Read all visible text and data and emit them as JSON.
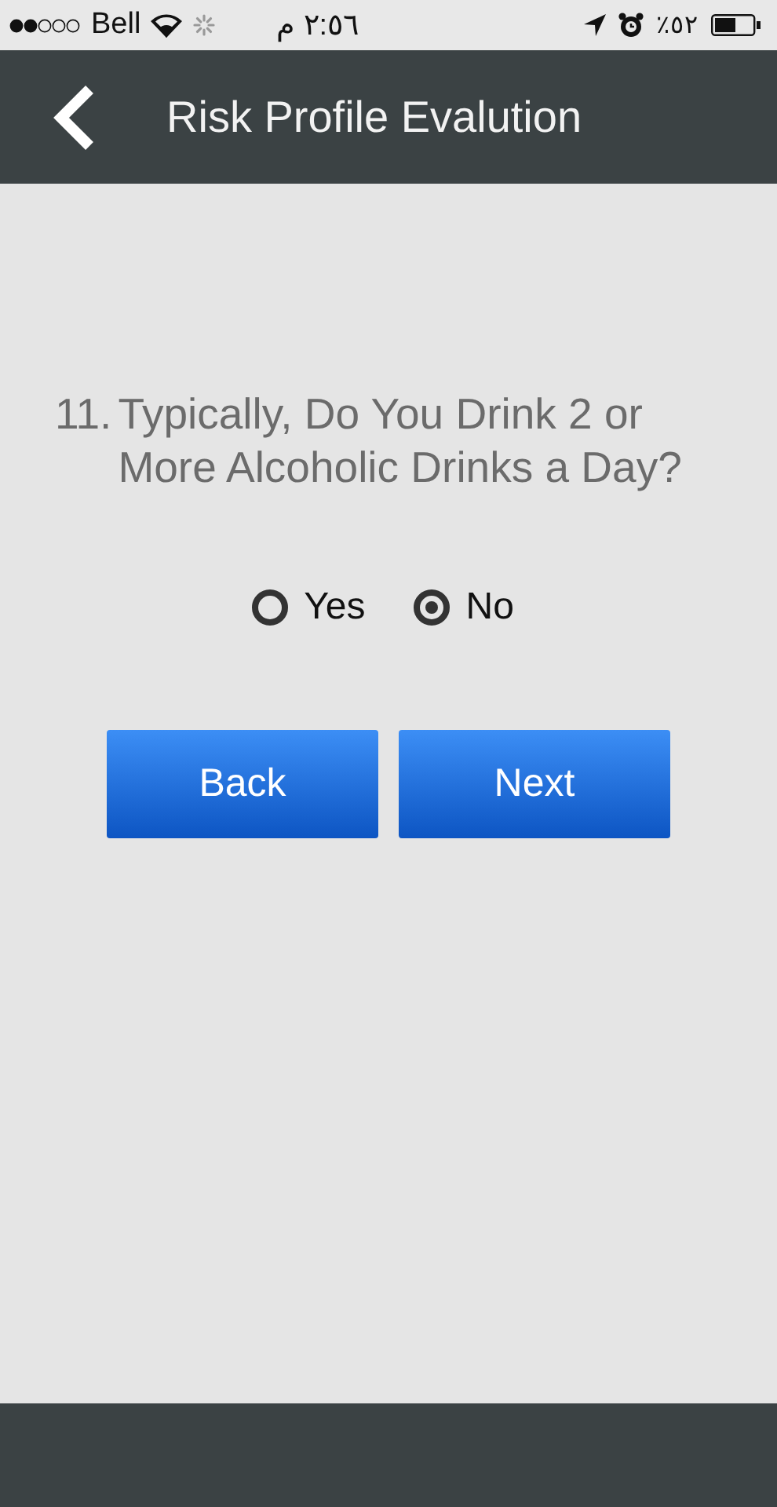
{
  "status_bar": {
    "carrier": "Bell",
    "time": "٢:٥٦ م",
    "battery": "٪٥٢"
  },
  "header": {
    "title": "Risk Profile Evalution"
  },
  "question": {
    "number": "11.",
    "text": "Typically, Do You Drink 2 or More Alcoholic Drinks a Day?"
  },
  "options": [
    {
      "label": "Yes",
      "selected": false
    },
    {
      "label": "No",
      "selected": true
    }
  ],
  "buttons": [
    "Back",
    "Next"
  ]
}
